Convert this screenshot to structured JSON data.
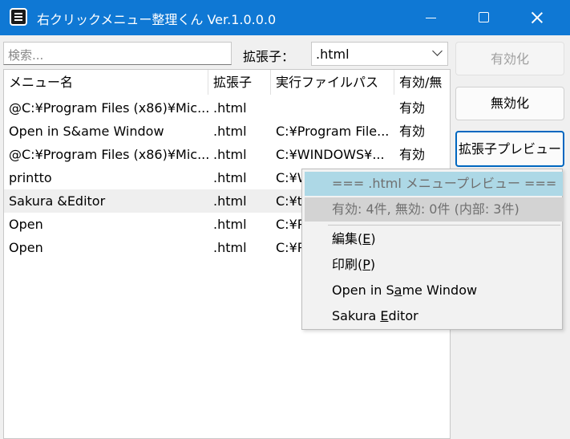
{
  "window": {
    "title": "右クリックメニュー整理くん Ver.1.0.0.0"
  },
  "toolbar": {
    "search_placeholder": "検索...",
    "ext_label": "拡張子：",
    "ext_selected": ".html"
  },
  "table": {
    "columns": [
      "メニュー名",
      "拡張子",
      "実行ファイルパス",
      "有効/無"
    ],
    "rows": [
      {
        "name": "@C:¥Program Files (x86)¥Mic...",
        "ext": ".html",
        "path": "",
        "status": "有効"
      },
      {
        "name": "Open in S&ame Window",
        "ext": ".html",
        "path": "C:¥Program File...",
        "status": "有効"
      },
      {
        "name": "@C:¥Program Files (x86)¥Mic...",
        "ext": ".html",
        "path": "C:¥WINDOWS¥...",
        "status": "有効"
      },
      {
        "name": "printto",
        "ext": ".html",
        "path": "C:¥W",
        "status": ""
      },
      {
        "name": "Sakura &Editor",
        "ext": ".html",
        "path": "C:¥t",
        "status": ""
      },
      {
        "name": "Open",
        "ext": ".html",
        "path": "C:¥P",
        "status": ""
      },
      {
        "name": "Open",
        "ext": ".html",
        "path": "C:¥P",
        "status": ""
      }
    ],
    "selected_row_index": 4
  },
  "buttons": {
    "enable": "有効化",
    "disable": "無効化",
    "preview": "拡張子プレビュー"
  },
  "context_menu": {
    "header": "=== .html メニュープレビュー ===",
    "counts": "有効: 4件, 無効: 0件 (内部: 3件)",
    "items": [
      {
        "pre": "編集(",
        "key": "E",
        "post": ")"
      },
      {
        "pre": "印刷(",
        "key": "P",
        "post": ")"
      },
      {
        "pre": "Open in S",
        "key": "a",
        "post": "me Window"
      },
      {
        "pre": "Sakura ",
        "key": "E",
        "post": "ditor"
      }
    ]
  }
}
